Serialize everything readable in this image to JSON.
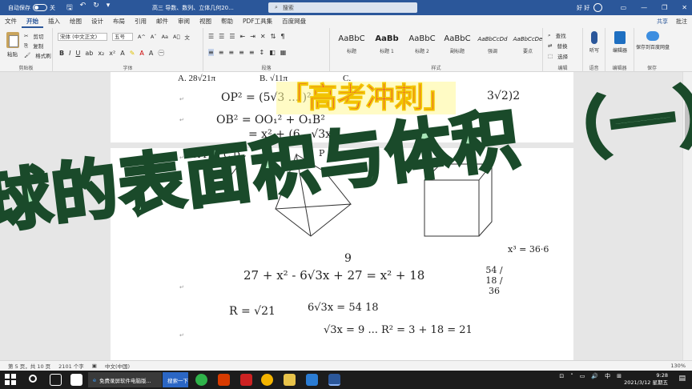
{
  "titlebar": {
    "autosave_label": "自动保存",
    "autosave_state": "关",
    "doc_title": "高三 导数、数列、立体几何20...",
    "search_placeholder": "搜索",
    "user_name": "好 好"
  },
  "tabs": [
    "文件",
    "开始",
    "插入",
    "绘图",
    "设计",
    "布局",
    "引用",
    "邮件",
    "审阅",
    "视图",
    "帮助",
    "PDF工具集",
    "百度网盘"
  ],
  "active_tab": "开始",
  "tabs_right": {
    "share": "共享",
    "comments": "批注"
  },
  "ribbon": {
    "clipboard": {
      "paste": "粘贴",
      "cut": "剪切",
      "copy": "复制",
      "format_painter": "格式刷",
      "label": "剪贴板"
    },
    "font": {
      "family": "宋体 (中文正文)",
      "size": "五号",
      "bold": "B",
      "italic": "I",
      "underline": "U",
      "label": "字体"
    },
    "paragraph": {
      "label": "段落"
    },
    "styles": {
      "items": [
        {
          "sample": "AaBbC",
          "name": "标题"
        },
        {
          "sample": "AaBb",
          "name": "标题 1"
        },
        {
          "sample": "AaBbC",
          "name": "标题 2"
        },
        {
          "sample": "AaBbC",
          "name": "副标题"
        },
        {
          "sample": "AaBbCcDd",
          "name": "强调"
        },
        {
          "sample": "AaBbCcDe",
          "name": "要点"
        }
      ],
      "label": "样式"
    },
    "editing": {
      "find": "查找",
      "replace": "替换",
      "select": "选择",
      "label": "编辑"
    },
    "voice": {
      "dictate": "听写",
      "label": "语音"
    },
    "editor": {
      "name": "编辑器",
      "label": "编辑器"
    },
    "save": {
      "name": "保存到百度网盘",
      "label": "保存"
    }
  },
  "document": {
    "options": [
      "A. 28√21π",
      "B. √11π",
      "C."
    ],
    "handwriting": {
      "op2": "OP² = (5√3 ... )²",
      "ob2": "OB² = OO₁² + O₁B²",
      "eq1": "= x² + (6 - √3x)²",
      "labels": "A  P  M  C  D",
      "label_p": "P",
      "label_ph": "PH",
      "x3": "x³ = 36·6",
      "nine": "9",
      "eq_main": "27 + x² - 6√3x + 27 = x² + 18",
      "frac": "54 / 18 / 36",
      "r_eq": "R = √21",
      "eq2": "6√3x = 54  18",
      "eq3": "√3x = 9   ...  R² = 3 + 18 = 21",
      "aside": "3√2)2"
    }
  },
  "overlay": {
    "title": "「高考冲刺」",
    "subtitle": "球的表面积与体积 （一）"
  },
  "statusbar": {
    "page": "第 5 页，共 10 页",
    "words": "2101 个字",
    "language": "中文(中国)",
    "zoom": "130%"
  },
  "taskbar": {
    "app1": "免费录屏软件电脑版...",
    "app2": "搜索一下",
    "time": "9:28",
    "date": "2021/3/12 星期五",
    "ime": "中"
  }
}
